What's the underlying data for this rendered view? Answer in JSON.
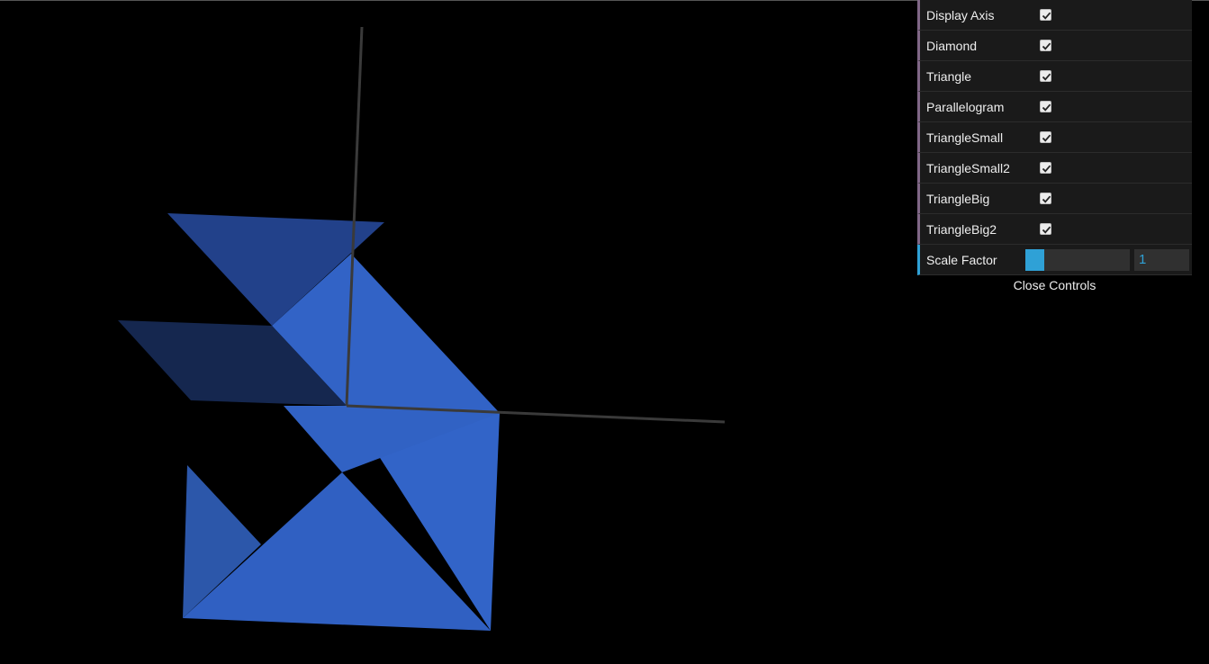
{
  "controls": {
    "toggles": [
      {
        "label": "Display Axis",
        "checked": true
      },
      {
        "label": "Diamond",
        "checked": true
      },
      {
        "label": "Triangle",
        "checked": true
      },
      {
        "label": "Parallelogram",
        "checked": true
      },
      {
        "label": "TriangleSmall",
        "checked": true
      },
      {
        "label": "TriangleSmall2",
        "checked": true
      },
      {
        "label": "TriangleBig",
        "checked": true
      },
      {
        "label": "TriangleBig2",
        "checked": true
      }
    ],
    "scale": {
      "label": "Scale Factor",
      "value": "1",
      "fill_fraction": 0.18
    },
    "close_label": "Close Controls"
  },
  "colors": {
    "background": "#000000",
    "panel_bg": "#1a1a1a",
    "boolean_accent": "#806787",
    "number_accent": "#2fa1d6",
    "axis": "#3a3a3a",
    "shape_main": "#3163c7",
    "shape_dark": "#24458f",
    "shape_darker": "#14254e"
  }
}
